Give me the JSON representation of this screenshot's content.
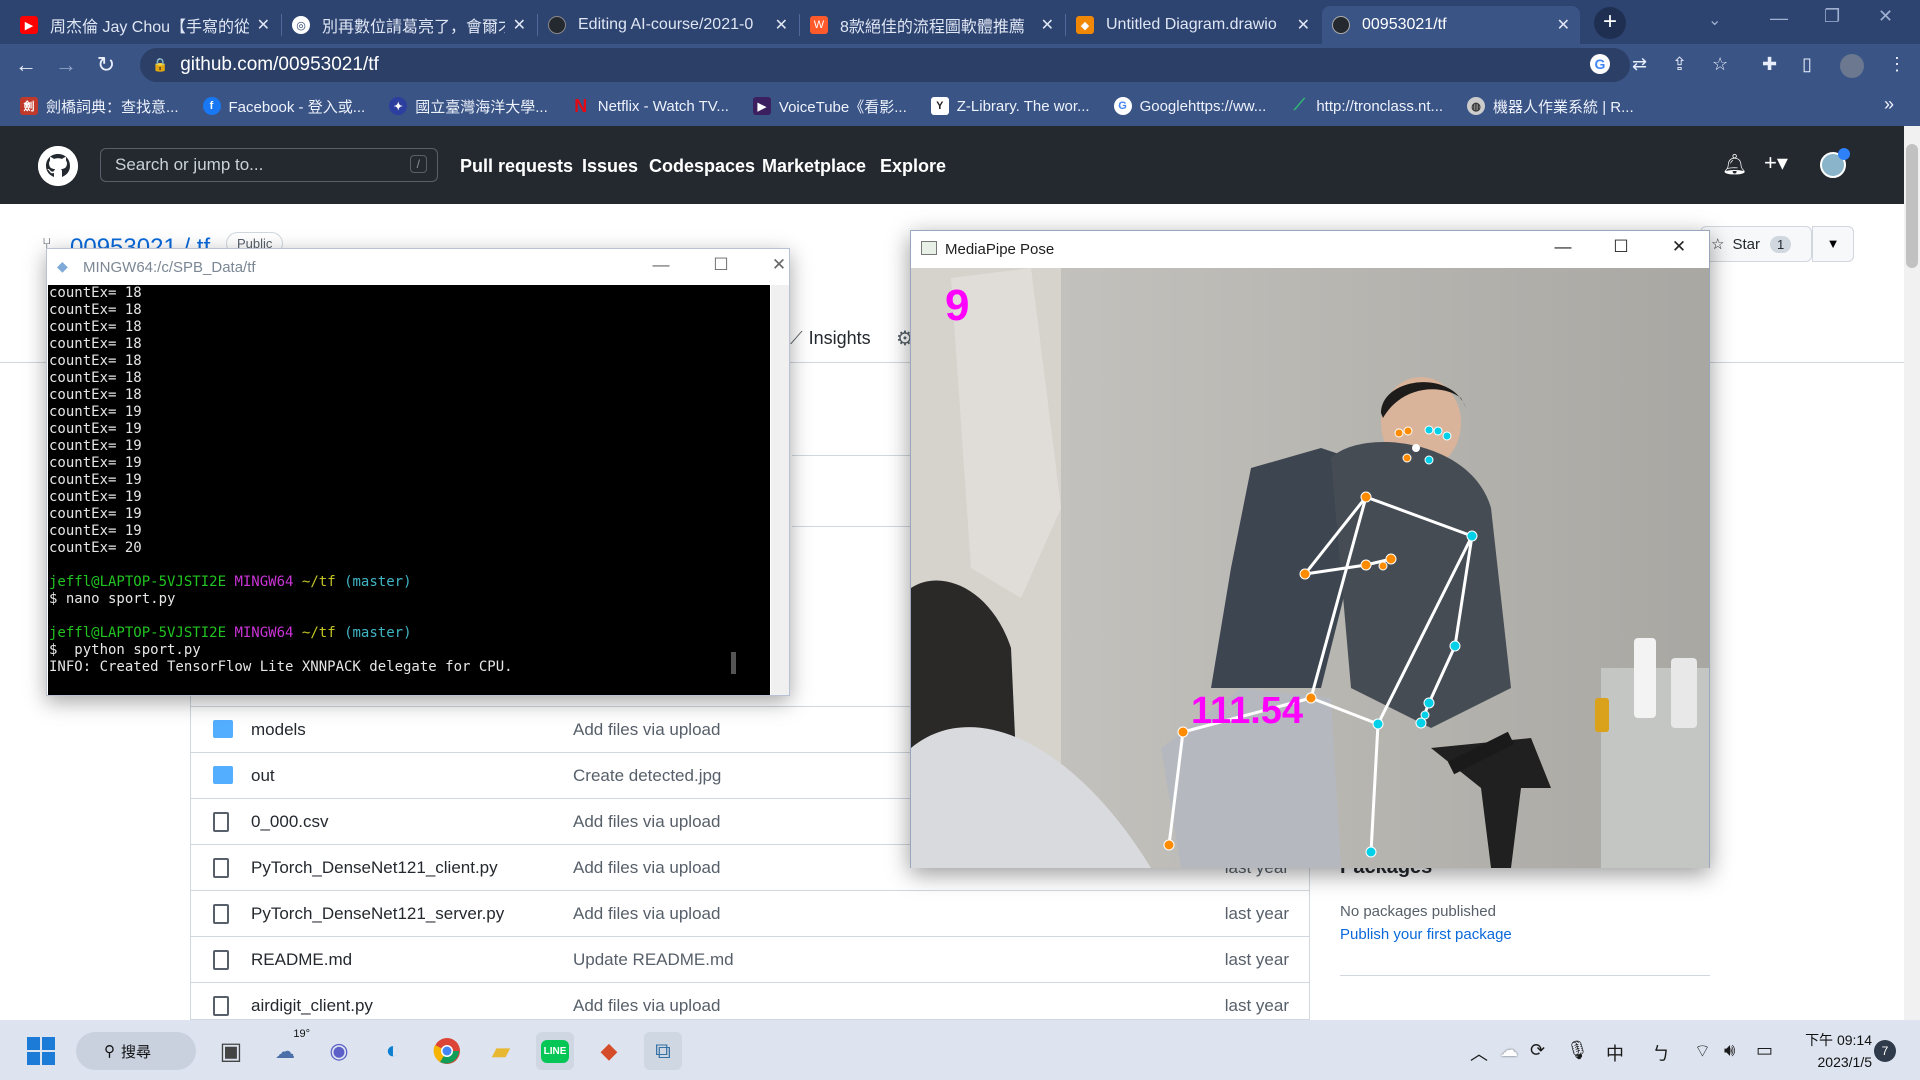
{
  "browser": {
    "tabs": [
      {
        "title": "周杰倫 Jay Chou【手寫的從",
        "icon": "youtube-icon",
        "color": "#ff0000"
      },
      {
        "title": "別再數位請葛亮了，會爾才",
        "icon": "chrome-site-icon",
        "color": "#ffffff"
      },
      {
        "title": "Editing AI-course/2021-0",
        "icon": "github-icon",
        "color": "#24292f"
      },
      {
        "title": "8款絕佳的流程圖軟體推薦",
        "icon": "wondershare-icon",
        "color": "#ff5a2c"
      },
      {
        "title": "Untitled Diagram.drawio",
        "icon": "drawio-icon",
        "color": "#f08705"
      },
      {
        "title": "00953021/tf",
        "icon": "github-icon",
        "color": "#24292f",
        "active": true
      }
    ],
    "new_tab": "+",
    "url": "github.com/00953021/tf",
    "bookmarks": [
      {
        "label": "劍橋詞典：查找意...",
        "icon": "cambridge-icon",
        "color": "#c0392b"
      },
      {
        "label": "Facebook - 登入或...",
        "icon": "facebook-icon",
        "color": "#1877f2"
      },
      {
        "label": "國立臺灣海洋大學...",
        "icon": "ntou-icon",
        "color": "#2c3e9e"
      },
      {
        "label": "Netflix - Watch TV...",
        "icon": "netflix-icon",
        "color": "#e50914"
      },
      {
        "label": "VoiceTube《看影...",
        "icon": "voicetube-icon",
        "color": "#3b1f5e"
      },
      {
        "label": "Z-Library. The wor...",
        "icon": "zlibrary-icon",
        "color": "#ffffff"
      },
      {
        "label": "Googlehttps://ww...",
        "icon": "google-icon",
        "color": "#ffffff"
      },
      {
        "label": "http://tronclass.nt...",
        "icon": "tronclass-icon",
        "color": "#2eb872"
      },
      {
        "label": "機器人作業系統 | R...",
        "icon": "globe-icon",
        "color": "#cccccc"
      }
    ],
    "more_bookmarks": "»"
  },
  "github": {
    "search_placeholder": "Search or jump to...",
    "search_shortcut": "/",
    "nav": [
      "Pull requests",
      "Issues",
      "Codespaces",
      "Marketplace",
      "Explore"
    ],
    "repo_title": "00953021 / tf",
    "visibility": "Public",
    "star_label": "Star",
    "star_count": "1",
    "insights_tab": "Insights",
    "files": [
      {
        "name": "models",
        "type": "folder",
        "message": "Add files via upload",
        "age": ""
      },
      {
        "name": "out",
        "type": "folder",
        "message": "Create detected.jpg",
        "age": ""
      },
      {
        "name": "0_000.csv",
        "type": "file",
        "message": "Add files via upload",
        "age": ""
      },
      {
        "name": "PyTorch_DenseNet121_client.py",
        "type": "file",
        "message": "Add files via upload",
        "age": "last year"
      },
      {
        "name": "PyTorch_DenseNet121_server.py",
        "type": "file",
        "message": "Add files via upload",
        "age": "last year"
      },
      {
        "name": "README.md",
        "type": "file",
        "message": "Update README.md",
        "age": "last year"
      },
      {
        "name": "airdigit_client.py",
        "type": "file",
        "message": "Add files via upload",
        "age": "last year"
      }
    ],
    "packages_heading": "Packages",
    "no_packages": "No packages published",
    "publish_link": "Publish your first package"
  },
  "terminal": {
    "title": "MINGW64:/c/SPB_Data/tf",
    "lines": [
      "countEx= 18",
      "countEx= 18",
      "countEx= 18",
      "countEx= 18",
      "countEx= 18",
      "countEx= 18",
      "countEx= 18",
      "countEx= 19",
      "countEx= 19",
      "countEx= 19",
      "countEx= 19",
      "countEx= 19",
      "countEx= 19",
      "countEx= 19",
      "countEx= 19",
      "countEx= 20"
    ],
    "prompt_user": "jeffl@LAPTOP-5VJSTI2E",
    "prompt_shell": "MINGW64",
    "prompt_path": "~/tf",
    "prompt_branch": "(master)",
    "cmd1": "$ nano sport.py",
    "cmd2": "$  python sport.py",
    "info": "INFO: Created TensorFlow Lite XNNPACK delegate for CPU."
  },
  "mediapipe": {
    "title": "MediaPipe Pose",
    "count": "9",
    "angle": "111.54",
    "overlay_color": "#ff00ff",
    "left_joint_color": "#ff8c00",
    "right_joint_color": "#00d0e8"
  },
  "taskbar": {
    "search_label": "搜尋",
    "weather": "19°",
    "ime": "中",
    "ime2": "ㄅ",
    "time": "下午 09:14",
    "date": "2023/1/5",
    "notifications": "7",
    "apps": [
      "windows-start-icon",
      "task-view-icon",
      "weather-icon",
      "zoom-icon",
      "edge-icon",
      "chrome-icon",
      "file-explorer-icon",
      "line-icon",
      "git-icon",
      "python-icon"
    ]
  }
}
